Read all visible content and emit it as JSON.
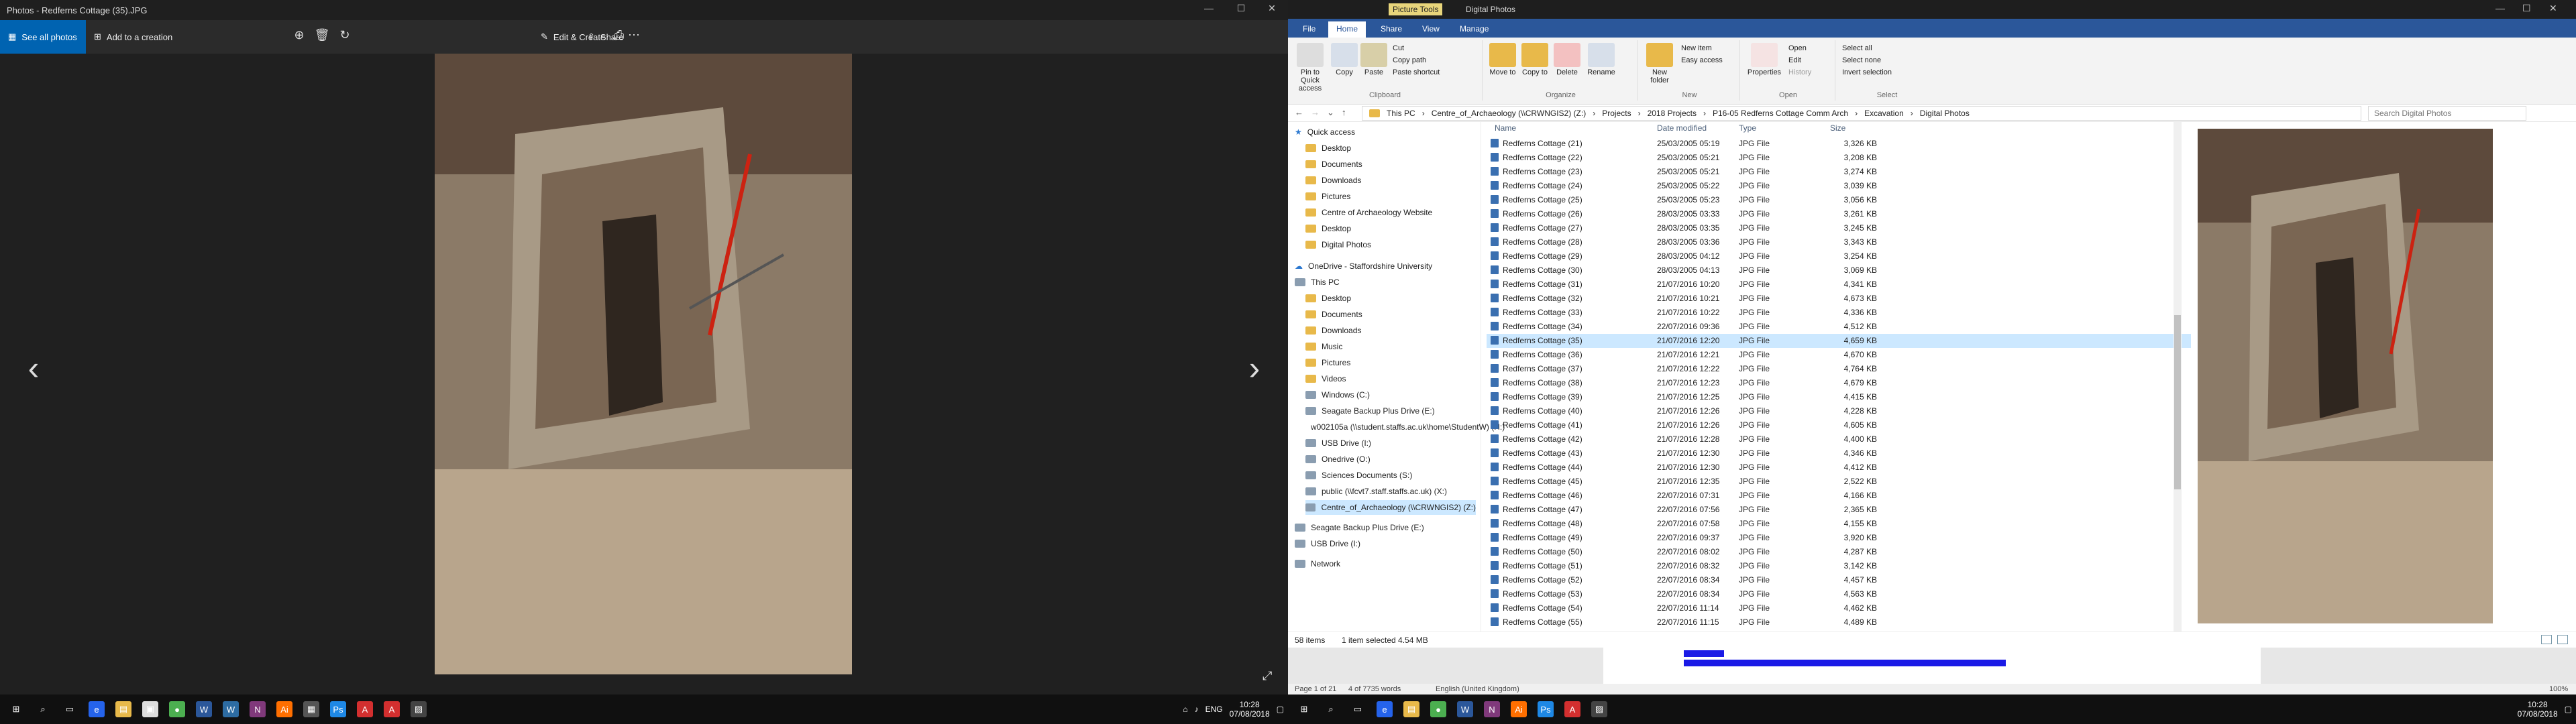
{
  "left": {
    "title": "Photos - Redferns Cottage (35).JPG",
    "see_all": "See all photos",
    "add_creation": "Add to a creation",
    "edit_create": "Edit & Create",
    "share": "Share",
    "taskbar_time": "10:28",
    "taskbar_date": "07/08/2018",
    "taskbar_lang": "ENG"
  },
  "right": {
    "window_labels": {
      "picture_tools": "Picture Tools",
      "title": "Digital Photos"
    },
    "tabs": [
      "File",
      "Home",
      "Share",
      "View",
      "Manage"
    ],
    "ribbon": {
      "pin_quick": "Pin to Quick access",
      "copy": "Copy",
      "paste": "Paste",
      "cut": "Cut",
      "copy_path": "Copy path",
      "paste_shortcut": "Paste shortcut",
      "move_to": "Move to",
      "copy_to": "Copy to",
      "delete": "Delete",
      "rename": "Rename",
      "new_folder": "New folder",
      "new_item": "New item",
      "easy_access": "Easy access",
      "properties": "Properties",
      "open": "Open",
      "edit": "Edit",
      "history": "History",
      "select_all": "Select all",
      "select_none": "Select none",
      "invert_selection": "Invert selection",
      "clipboard": "Clipboard",
      "organize": "Organize",
      "new": "New",
      "open_group": "Open",
      "select": "Select"
    },
    "address": [
      "This PC",
      "Centre_of_Archaeology (\\\\CRWNGIS2) (Z:)",
      "Projects",
      "2018 Projects",
      "P16-05 Redferns Cottage Comm Arch",
      "Excavation",
      "Digital Photos"
    ],
    "search_placeholder": "Search Digital Photos",
    "nav": [
      "Quick access",
      "Desktop",
      "Documents",
      "Downloads",
      "Pictures",
      "Centre of Archaeology Website",
      "Desktop",
      "Digital Photos",
      "OneDrive - Staffordshire University",
      "This PC",
      "Desktop",
      "Documents",
      "Downloads",
      "Music",
      "Pictures",
      "Videos",
      "Windows (C:)",
      "Seagate Backup Plus Drive (E:)",
      "w002105a (\\\\student.staffs.ac.uk\\home\\StudentW) (H:)",
      "USB Drive (I:)",
      "Onedrive (O:)",
      "Sciences Documents (S:)",
      "public (\\\\fcvt7.staff.staffs.ac.uk) (X:)",
      "Centre_of_Archaeology (\\\\CRWNGIS2) (Z:)",
      "Seagate Backup Plus Drive (E:)",
      "USB Drive (I:)",
      "Network"
    ],
    "columns": {
      "name": "Name",
      "date": "Date modified",
      "type": "Type",
      "size": "Size"
    },
    "files": [
      [
        "Redferns Cottage (21)",
        "25/03/2005 05:19",
        "JPG File",
        "3,326 KB"
      ],
      [
        "Redferns Cottage (22)",
        "25/03/2005 05:21",
        "JPG File",
        "3,208 KB"
      ],
      [
        "Redferns Cottage (23)",
        "25/03/2005 05:21",
        "JPG File",
        "3,274 KB"
      ],
      [
        "Redferns Cottage (24)",
        "25/03/2005 05:22",
        "JPG File",
        "3,039 KB"
      ],
      [
        "Redferns Cottage (25)",
        "25/03/2005 05:23",
        "JPG File",
        "3,056 KB"
      ],
      [
        "Redferns Cottage (26)",
        "28/03/2005 03:33",
        "JPG File",
        "3,261 KB"
      ],
      [
        "Redferns Cottage (27)",
        "28/03/2005 03:35",
        "JPG File",
        "3,245 KB"
      ],
      [
        "Redferns Cottage (28)",
        "28/03/2005 03:36",
        "JPG File",
        "3,343 KB"
      ],
      [
        "Redferns Cottage (29)",
        "28/03/2005 04:12",
        "JPG File",
        "3,254 KB"
      ],
      [
        "Redferns Cottage (30)",
        "28/03/2005 04:13",
        "JPG File",
        "3,069 KB"
      ],
      [
        "Redferns Cottage (31)",
        "21/07/2016 10:20",
        "JPG File",
        "4,341 KB"
      ],
      [
        "Redferns Cottage (32)",
        "21/07/2016 10:21",
        "JPG File",
        "4,673 KB"
      ],
      [
        "Redferns Cottage (33)",
        "21/07/2016 10:22",
        "JPG File",
        "4,336 KB"
      ],
      [
        "Redferns Cottage (34)",
        "22/07/2016 09:36",
        "JPG File",
        "4,512 KB"
      ],
      [
        "Redferns Cottage (35)",
        "21/07/2016 12:20",
        "JPG File",
        "4,659 KB"
      ],
      [
        "Redferns Cottage (36)",
        "21/07/2016 12:21",
        "JPG File",
        "4,670 KB"
      ],
      [
        "Redferns Cottage (37)",
        "21/07/2016 12:22",
        "JPG File",
        "4,764 KB"
      ],
      [
        "Redferns Cottage (38)",
        "21/07/2016 12:23",
        "JPG File",
        "4,679 KB"
      ],
      [
        "Redferns Cottage (39)",
        "21/07/2016 12:25",
        "JPG File",
        "4,415 KB"
      ],
      [
        "Redferns Cottage (40)",
        "21/07/2016 12:26",
        "JPG File",
        "4,228 KB"
      ],
      [
        "Redferns Cottage (41)",
        "21/07/2016 12:26",
        "JPG File",
        "4,605 KB"
      ],
      [
        "Redferns Cottage (42)",
        "21/07/2016 12:28",
        "JPG File",
        "4,400 KB"
      ],
      [
        "Redferns Cottage (43)",
        "21/07/2016 12:30",
        "JPG File",
        "4,346 KB"
      ],
      [
        "Redferns Cottage (44)",
        "21/07/2016 12:30",
        "JPG File",
        "4,412 KB"
      ],
      [
        "Redferns Cottage (45)",
        "21/07/2016 12:35",
        "JPG File",
        "2,522 KB"
      ],
      [
        "Redferns Cottage (46)",
        "22/07/2016 07:31",
        "JPG File",
        "4,166 KB"
      ],
      [
        "Redferns Cottage (47)",
        "22/07/2016 07:56",
        "JPG File",
        "2,365 KB"
      ],
      [
        "Redferns Cottage (48)",
        "22/07/2016 07:58",
        "JPG File",
        "4,155 KB"
      ],
      [
        "Redferns Cottage (49)",
        "22/07/2016 09:37",
        "JPG File",
        "3,920 KB"
      ],
      [
        "Redferns Cottage (50)",
        "22/07/2016 08:02",
        "JPG File",
        "4,287 KB"
      ],
      [
        "Redferns Cottage (51)",
        "22/07/2016 08:32",
        "JPG File",
        "3,142 KB"
      ],
      [
        "Redferns Cottage (52)",
        "22/07/2016 08:34",
        "JPG File",
        "4,457 KB"
      ],
      [
        "Redferns Cottage (53)",
        "22/07/2016 08:34",
        "JPG File",
        "4,563 KB"
      ],
      [
        "Redferns Cottage (54)",
        "22/07/2016 11:14",
        "JPG File",
        "4,462 KB"
      ],
      [
        "Redferns Cottage (55)",
        "22/07/2016 11:15",
        "JPG File",
        "4,489 KB"
      ]
    ],
    "selected_file_index": 14,
    "status_items": "58 items",
    "status_selected": "1 item selected  4.54 MB",
    "word_status_page": "Page 1 of 21",
    "word_status_words": "4 of 7735 words",
    "word_status_lang": "English (United Kingdom)",
    "word_zoom": "100%",
    "taskbar_time": "10:28",
    "taskbar_date": "07/08/2018"
  }
}
